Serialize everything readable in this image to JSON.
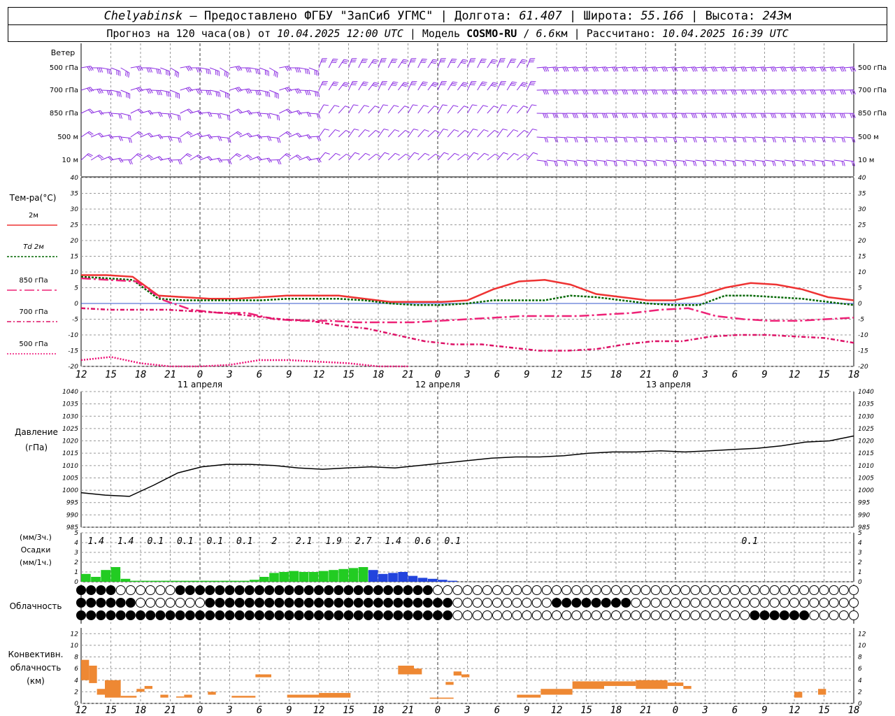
{
  "header": {
    "city": "Chelyabinsk",
    "dash": "—",
    "provider": "Предоставлено ФГБУ \"ЗапСиб УГМС\"",
    "sep": "|",
    "lon_label": "Долгота:",
    "lon": "61.407",
    "lat_label": "Широта:",
    "lat": "55.166",
    "alt_label": "Высота:",
    "alt": "243",
    "alt_unit": "м",
    "forecast_label": "Прогноз на 120 часа(ов) от",
    "forecast_from": "10.04.2025 12:00 UTC",
    "model_label": "Модель",
    "model": "COSMO-RU",
    "model_res": "6.6",
    "model_res_unit": "км",
    "calc_label": "Рассчитано:",
    "calc_time": "10.04.2025 16:39 UTC"
  },
  "labels": {
    "wind": "Ветер",
    "wind_levels": [
      "500 гПа",
      "700 гПа",
      "850 гПа",
      "500 м",
      "10  м"
    ],
    "temp_title": "Тем-ра(°C)",
    "temp_legend": [
      "2м",
      "Td  2м",
      "850 гПа",
      "700 гПа",
      "500 гПа"
    ],
    "pressure_title": "Давление",
    "pressure_unit": "(гПа)",
    "precip_unit3": "(мм/3ч.)",
    "precip_title": "Осадки",
    "precip_unit1": "(мм/1ч.)",
    "cloud_title": "Облачность",
    "conv_title": [
      "Конвективн.",
      "облачность",
      "(км)"
    ],
    "dates": [
      "11 апреля",
      "12 апреля",
      "13 апреля"
    ]
  },
  "colors": {
    "wind": "#8a2be2",
    "t2m": "#ee3333",
    "td2m": "#006600",
    "t850": "#ee2277",
    "t700": "#dd1166",
    "t500": "#ee1177",
    "pressure": "#000000",
    "rain": "#22cc22",
    "snow": "#2244dd",
    "conv": "#ee8833",
    "grid": "#999999"
  },
  "chart_data": {
    "time_axis": {
      "start": "10.04.2025 12:00 UTC",
      "hour_labels": [
        "12",
        "15",
        "18",
        "21",
        "0",
        "3",
        "6",
        "9",
        "12",
        "15",
        "18",
        "21",
        "0",
        "3",
        "6",
        "9",
        "12",
        "15",
        "18",
        "21",
        "0",
        "3",
        "6",
        "9",
        "12",
        "15",
        "18"
      ]
    },
    "temperature": {
      "type": "line",
      "ylim": [
        -20,
        40
      ],
      "yticks": [
        -20,
        -15,
        -10,
        -5,
        0,
        5,
        10,
        15,
        20,
        25,
        30,
        35,
        40
      ],
      "x_hours": [
        0,
        3,
        6,
        9,
        12,
        15,
        18,
        21,
        24,
        27,
        30,
        33,
        36,
        39,
        42,
        45,
        48,
        51,
        54,
        57,
        60,
        63,
        66,
        69,
        72,
        75,
        78
      ],
      "series": [
        {
          "name": "2м",
          "values": [
            9,
            9,
            8.5,
            2.5,
            2,
            1.5,
            1.5,
            2,
            2.5,
            2.5,
            2.5,
            1.5,
            0.5,
            0.5,
            0.5,
            1,
            4.5,
            7,
            7.5,
            6,
            3,
            2,
            1,
            1,
            2.5,
            5,
            6.5,
            6,
            4.5,
            2,
            1
          ]
        },
        {
          "name": "Td  2м",
          "values": [
            8.5,
            8,
            7.5,
            1.5,
            1,
            1,
            1,
            1,
            1.5,
            1.5,
            1.5,
            1,
            0,
            -0.5,
            -0.5,
            0,
            1,
            1,
            1,
            2.5,
            2,
            1,
            0,
            -0.5,
            -0.5,
            2.5,
            2.5,
            2,
            1.5,
            0.5,
            -0.5
          ]
        },
        {
          "name": "850 гПа",
          "values": [
            8,
            7.5,
            7,
            1,
            -2,
            -3,
            -3,
            -5,
            -5.5,
            -5.5,
            -6,
            -6,
            -6,
            -5.5,
            -5,
            -4.5,
            -4,
            -4,
            -4,
            -3.5,
            -3,
            -2,
            -1.5,
            -4,
            -5,
            -5.5,
            -5.5,
            -5,
            -4.5
          ]
        },
        {
          "name": "700 гПа",
          "values": [
            -1.5,
            -2,
            -2,
            -2,
            -2.5,
            -3,
            -4,
            -5,
            -5.5,
            -7,
            -8,
            -10,
            -12,
            -13,
            -13,
            -14,
            -15,
            -15,
            -14.5,
            -13,
            -12,
            -12,
            -10.5,
            -10,
            -10,
            -10.5,
            -11,
            -12.5
          ]
        },
        {
          "name": "500 гПа",
          "values": [
            -18,
            -17,
            -19,
            -20,
            -20,
            -19.5,
            -18,
            -18,
            -18.5,
            -19,
            -20,
            -20
          ]
        }
      ]
    },
    "pressure": {
      "type": "line",
      "ylim": [
        985,
        1040
      ],
      "yticks": [
        985,
        990,
        995,
        1000,
        1005,
        1010,
        1015,
        1020,
        1025,
        1030,
        1035,
        1040
      ],
      "values": [
        999,
        998,
        997.5,
        1002,
        1007,
        1009.5,
        1010.5,
        1010.5,
        1010,
        1009,
        1008.5,
        1009,
        1009.5,
        1009,
        1010,
        1011,
        1012,
        1013,
        1013.5,
        1013.5,
        1014,
        1015,
        1015.5,
        1015.5,
        1016,
        1015.5,
        1016,
        1016.5,
        1017,
        1018,
        1019.5,
        1020,
        1022
      ]
    },
    "precip_3h_labels": [
      "1.4",
      "1.4",
      "0.1",
      "0.1",
      "0.1",
      "0.1",
      "2",
      "2.1",
      "1.9",
      "2.7",
      "1.4",
      "0.6",
      "0.1",
      "0.1"
    ],
    "precip": {
      "type": "bar",
      "ylim": [
        0,
        5
      ],
      "yticks": [
        0,
        1,
        2,
        3,
        4,
        5
      ],
      "rain_values": [
        0.8,
        0.5,
        1.2,
        1.5,
        0.3,
        0.1,
        0.1,
        0.1,
        0.1,
        0.1,
        0.1,
        0.1,
        0.1,
        0.1,
        0.1,
        0.1,
        0.1,
        0.2,
        0.5,
        0.9,
        1.0,
        1.1,
        1.0,
        1.0,
        1.1,
        1.2,
        1.3,
        1.4,
        1.5
      ],
      "snow_values": [
        0.0,
        1.2,
        0.8,
        0.9,
        1.0,
        0.6,
        0.4,
        0.3,
        0.2,
        0.1
      ]
    },
    "convective": {
      "type": "bar",
      "ylim": [
        0,
        13
      ],
      "yticks": [
        0,
        2,
        4,
        6,
        8,
        10,
        12
      ]
    }
  }
}
